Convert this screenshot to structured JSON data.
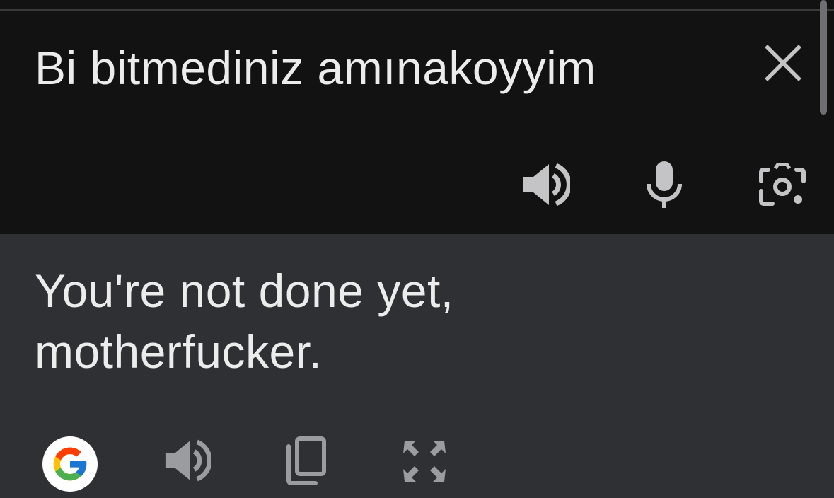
{
  "source": {
    "text": "Bi bitmediniz amınakoyyim"
  },
  "translation": {
    "text": "You're not done yet,\nmotherfucker."
  },
  "icons": {
    "close": "close-icon",
    "source_speaker": "speaker-icon",
    "microphone": "microphone-icon",
    "camera": "camera-lens-icon",
    "google": "google-g-icon",
    "translation_speaker": "speaker-icon",
    "copy": "copy-icon",
    "fullscreen": "fullscreen-icon"
  },
  "colors": {
    "source_background": "#121212",
    "translation_background": "#2f3034",
    "text": "#ececec",
    "icon": "#c4c4c6",
    "icon_dim": "#9a9ca0"
  }
}
